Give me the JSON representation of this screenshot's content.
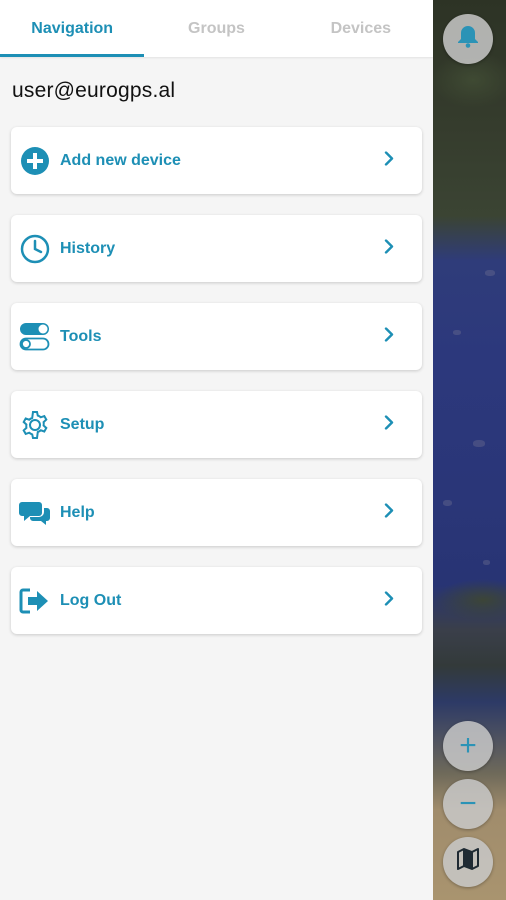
{
  "tabs": [
    {
      "label": "Navigation",
      "active": true
    },
    {
      "label": "Groups",
      "active": false
    },
    {
      "label": "Devices",
      "active": false
    }
  ],
  "user": {
    "email": "user@eurogps.al"
  },
  "menu": {
    "items": [
      {
        "label": "Add new device",
        "icon": "plus-circle-icon"
      },
      {
        "label": "History",
        "icon": "clock-icon"
      },
      {
        "label": "Tools",
        "icon": "toggle-icon"
      },
      {
        "label": "Setup",
        "icon": "gear-icon"
      },
      {
        "label": "Help",
        "icon": "chat-bubbles-icon"
      },
      {
        "label": "Log Out",
        "icon": "logout-icon"
      }
    ]
  },
  "map_controls": {
    "bell": "bell-icon",
    "zoom_in": "+",
    "zoom_out": "−",
    "layers": "map-icon"
  },
  "colors": {
    "accent": "#1d8fb5",
    "tab_inactive": "#c4c4c4",
    "background": "#f5f5f5"
  }
}
